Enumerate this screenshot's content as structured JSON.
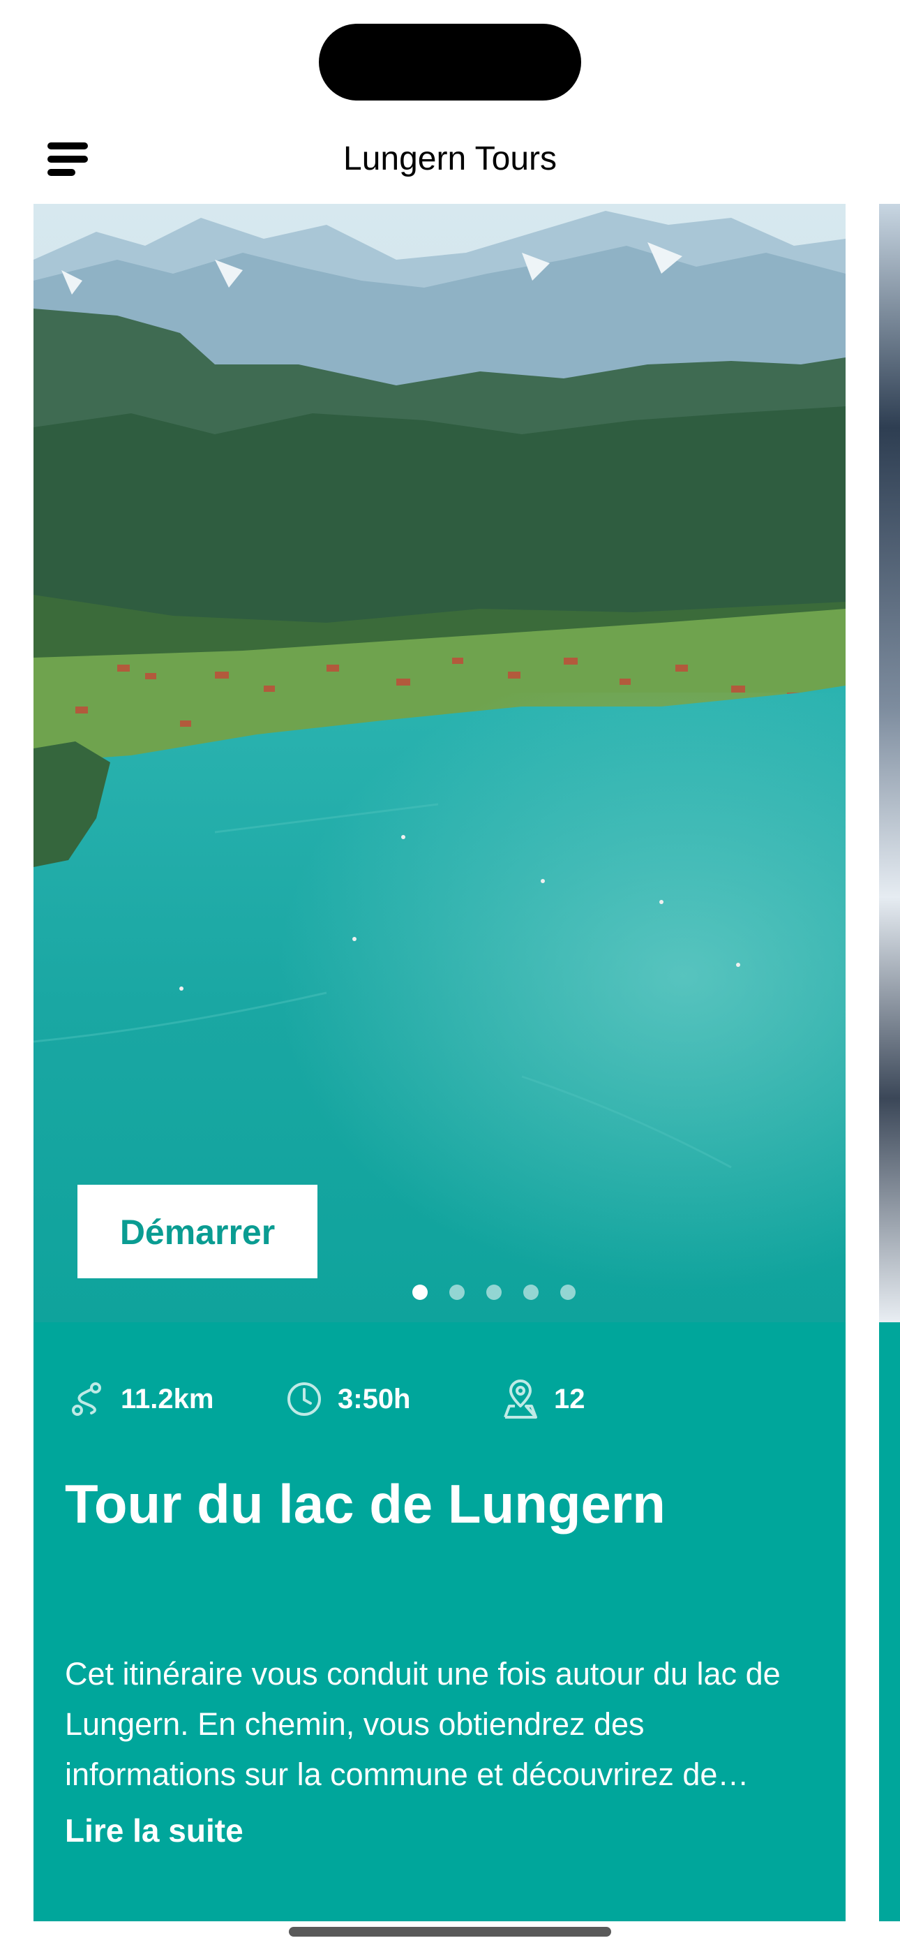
{
  "header": {
    "title": "Lungern Tours",
    "menu_icon": "hamburger-menu-icon"
  },
  "carousel": {
    "slide_count": 5,
    "active_index": 0
  },
  "tour": {
    "start_label": "Démarrer",
    "stats": [
      {
        "icon": "route-icon",
        "value": "11.2km"
      },
      {
        "icon": "clock-icon",
        "value": "3:50h"
      },
      {
        "icon": "map-pin-icon",
        "value": "12"
      }
    ],
    "title": "Tour du lac de Lungern",
    "description": "Cet itinéraire vous conduit une fois autour du lac de Lungern. En chemin, vous obtiendrez des informations sur la commune et découvrirez de…",
    "read_more": "Lire la suite"
  },
  "colors": {
    "accent": "#00a69b",
    "button_text": "#0a9c92"
  }
}
